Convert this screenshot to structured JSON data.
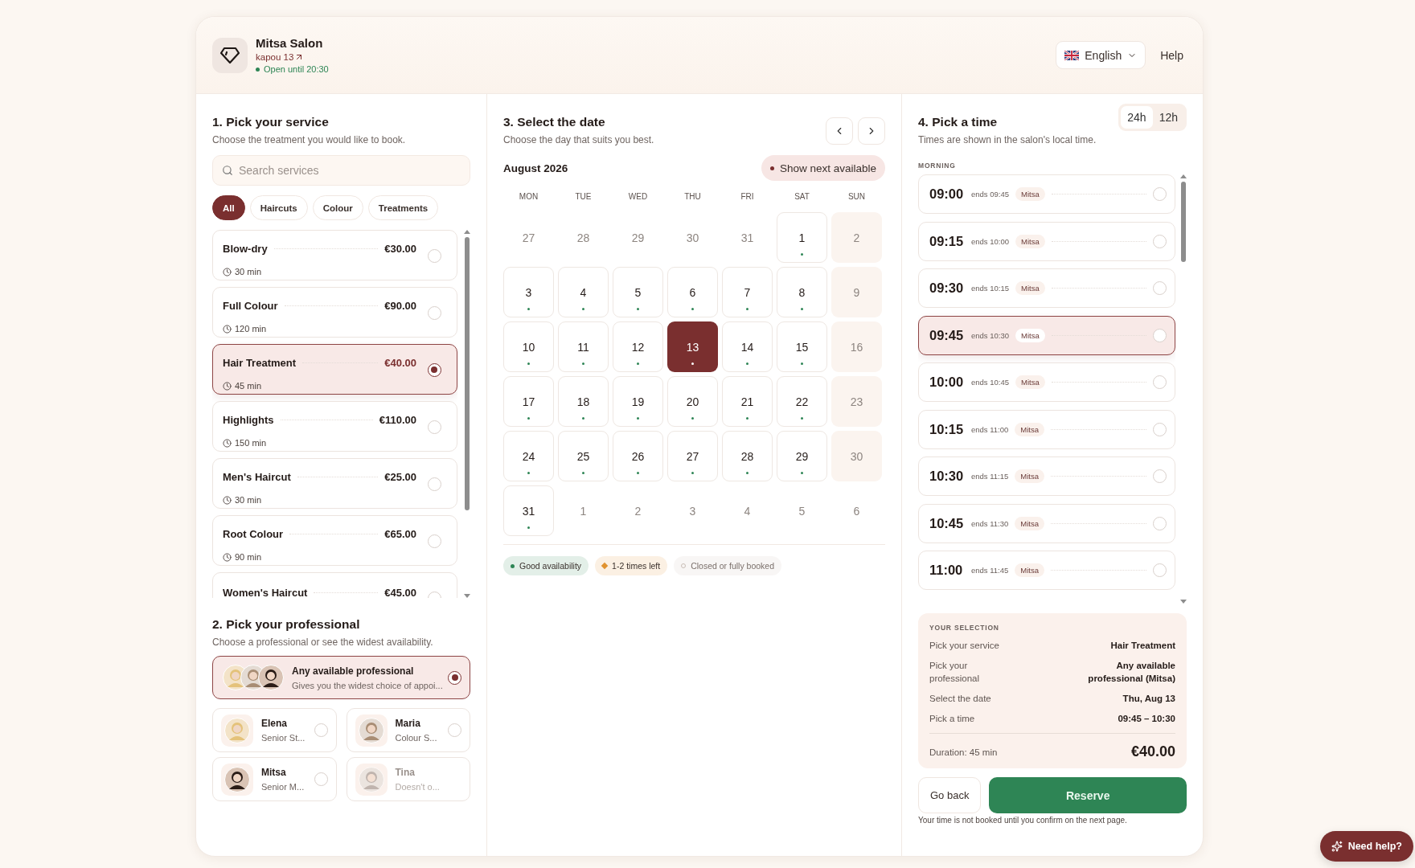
{
  "header": {
    "salon_name": "Mitsa Salon",
    "address": "kapou 13",
    "status": {
      "text": "Open until 20:30",
      "open": true
    },
    "language": "English",
    "help": "Help"
  },
  "service_section": {
    "title": "1. Pick your service",
    "subtitle": "Choose the treatment you would like to book.",
    "search_placeholder": "Search services",
    "filters": [
      {
        "label": "All",
        "selected": true
      },
      {
        "label": "Haircuts",
        "selected": false
      },
      {
        "label": "Colour",
        "selected": false
      },
      {
        "label": "Treatments",
        "selected": false
      }
    ],
    "services": [
      {
        "name": "Blow-dry",
        "price": "€30.00",
        "duration": "30 min",
        "selected": false
      },
      {
        "name": "Full Colour",
        "price": "€90.00",
        "duration": "120 min",
        "selected": false
      },
      {
        "name": "Hair Treatment",
        "price": "€40.00",
        "duration": "45 min",
        "selected": true
      },
      {
        "name": "Highlights",
        "price": "€110.00",
        "duration": "150 min",
        "selected": false
      },
      {
        "name": "Men's Haircut",
        "price": "€25.00",
        "duration": "30 min",
        "selected": false
      },
      {
        "name": "Root Colour",
        "price": "€65.00",
        "duration": "90 min",
        "selected": false
      },
      {
        "name": "Women's Haircut",
        "price": "€45.00",
        "selected": false
      }
    ]
  },
  "professional_section": {
    "title": "2. Pick your professional",
    "subtitle": "Choose a professional or see the widest availability.",
    "any": {
      "name": "Any available professional",
      "description": "Gives you the widest choice of appoi...",
      "selected": true
    },
    "professionals": [
      {
        "name": "Elena",
        "role": "Senior St...",
        "selected": false,
        "disabled": false
      },
      {
        "name": "Maria",
        "role": "Colour S...",
        "selected": false,
        "disabled": false
      },
      {
        "name": "Mitsa",
        "role": "Senior M...",
        "selected": false,
        "disabled": false
      },
      {
        "name": "Tina",
        "role": "Doesn't o...",
        "selected": false,
        "disabled": true
      }
    ]
  },
  "date_section": {
    "title": "3. Select the date",
    "subtitle": "Choose the day that suits you best.",
    "month": "August 2026",
    "next_available": "Show next available",
    "weekdays": [
      "MON",
      "TUE",
      "WED",
      "THU",
      "FRI",
      "SAT",
      "SUN"
    ],
    "days": [
      {
        "label": "27",
        "kind": "outside",
        "selected": false
      },
      {
        "label": "28",
        "kind": "outside",
        "selected": false
      },
      {
        "label": "29",
        "kind": "outside",
        "selected": false
      },
      {
        "label": "30",
        "kind": "outside",
        "selected": false
      },
      {
        "label": "31",
        "kind": "outside",
        "selected": false
      },
      {
        "label": "1",
        "kind": "open",
        "selected": false
      },
      {
        "label": "2",
        "kind": "closed",
        "selected": false
      },
      {
        "label": "3",
        "kind": "open",
        "selected": false
      },
      {
        "label": "4",
        "kind": "open",
        "selected": false
      },
      {
        "label": "5",
        "kind": "open",
        "selected": false
      },
      {
        "label": "6",
        "kind": "open",
        "selected": false
      },
      {
        "label": "7",
        "kind": "open",
        "selected": false
      },
      {
        "label": "8",
        "kind": "open",
        "selected": false
      },
      {
        "label": "9",
        "kind": "closed",
        "selected": false
      },
      {
        "label": "10",
        "kind": "open",
        "selected": false
      },
      {
        "label": "11",
        "kind": "open",
        "selected": false
      },
      {
        "label": "12",
        "kind": "open",
        "selected": false
      },
      {
        "label": "13",
        "kind": "open",
        "selected": true
      },
      {
        "label": "14",
        "kind": "open",
        "selected": false
      },
      {
        "label": "15",
        "kind": "open",
        "selected": false
      },
      {
        "label": "16",
        "kind": "closed",
        "selected": false
      },
      {
        "label": "17",
        "kind": "open",
        "selected": false
      },
      {
        "label": "18",
        "kind": "open",
        "selected": false
      },
      {
        "label": "19",
        "kind": "open",
        "selected": false
      },
      {
        "label": "20",
        "kind": "open",
        "selected": false
      },
      {
        "label": "21",
        "kind": "open",
        "selected": false
      },
      {
        "label": "22",
        "kind": "open",
        "selected": false
      },
      {
        "label": "23",
        "kind": "closed",
        "selected": false
      },
      {
        "label": "24",
        "kind": "open",
        "selected": false
      },
      {
        "label": "25",
        "kind": "open",
        "selected": false
      },
      {
        "label": "26",
        "kind": "open",
        "selected": false
      },
      {
        "label": "27",
        "kind": "open",
        "selected": false
      },
      {
        "label": "28",
        "kind": "open",
        "selected": false
      },
      {
        "label": "29",
        "kind": "open",
        "selected": false
      },
      {
        "label": "30",
        "kind": "closed",
        "selected": false
      },
      {
        "label": "31",
        "kind": "open",
        "selected": false
      },
      {
        "label": "1",
        "kind": "outside",
        "selected": false
      },
      {
        "label": "2",
        "kind": "outside",
        "selected": false
      },
      {
        "label": "3",
        "kind": "outside",
        "selected": false
      },
      {
        "label": "4",
        "kind": "outside",
        "selected": false
      },
      {
        "label": "5",
        "kind": "outside",
        "selected": false
      },
      {
        "label": "6",
        "kind": "outside",
        "selected": false
      }
    ],
    "legend": [
      {
        "label": "Good availability",
        "kind": "dot",
        "color": "#2e8555"
      },
      {
        "label": "1-2 times left",
        "kind": "diamond",
        "color": "#e0922f"
      },
      {
        "label": "Closed or fully booked",
        "kind": "ring",
        "color": "#c9bdb6"
      }
    ]
  },
  "time_section": {
    "title": "4. Pick a time",
    "subtitle": "Times are shown in the salon's local time.",
    "formats": [
      {
        "label": "24h",
        "selected": true
      },
      {
        "label": "12h",
        "selected": false
      }
    ],
    "period": "MORNING",
    "slots": [
      {
        "time": "09:00",
        "ends": "ends 09:45",
        "staff": "Mitsa",
        "selected": false
      },
      {
        "time": "09:15",
        "ends": "ends 10:00",
        "staff": "Mitsa",
        "selected": false
      },
      {
        "time": "09:30",
        "ends": "ends 10:15",
        "staff": "Mitsa",
        "selected": false
      },
      {
        "time": "09:45",
        "ends": "ends 10:30",
        "staff": "Mitsa",
        "selected": true
      },
      {
        "time": "10:00",
        "ends": "ends 10:45",
        "staff": "Mitsa",
        "selected": false
      },
      {
        "time": "10:15",
        "ends": "ends 11:00",
        "staff": "Mitsa",
        "selected": false
      },
      {
        "time": "10:30",
        "ends": "ends 11:15",
        "staff": "Mitsa",
        "selected": false
      },
      {
        "time": "10:45",
        "ends": "ends 11:30",
        "staff": "Mitsa",
        "selected": false
      },
      {
        "time": "11:00",
        "ends": "ends 11:45",
        "staff": "Mitsa",
        "selected": false
      }
    ]
  },
  "summary": {
    "title": "YOUR SELECTION",
    "rows": [
      {
        "label": "Pick your service",
        "value": "Hair Treatment"
      },
      {
        "label": "Pick your professional",
        "value": "Any available professional (Mitsa)"
      },
      {
        "label": "Select the date",
        "value": "Thu, Aug 13"
      },
      {
        "label": "Pick a time",
        "value": "09:45 – 10:30"
      }
    ],
    "duration": "Duration: 45 min",
    "total": "€40.00"
  },
  "actions": {
    "back": "Go back",
    "reserve": "Reserve",
    "note": "Your time is not booked until you confirm on the next page."
  },
  "help_button": "Need help?"
}
